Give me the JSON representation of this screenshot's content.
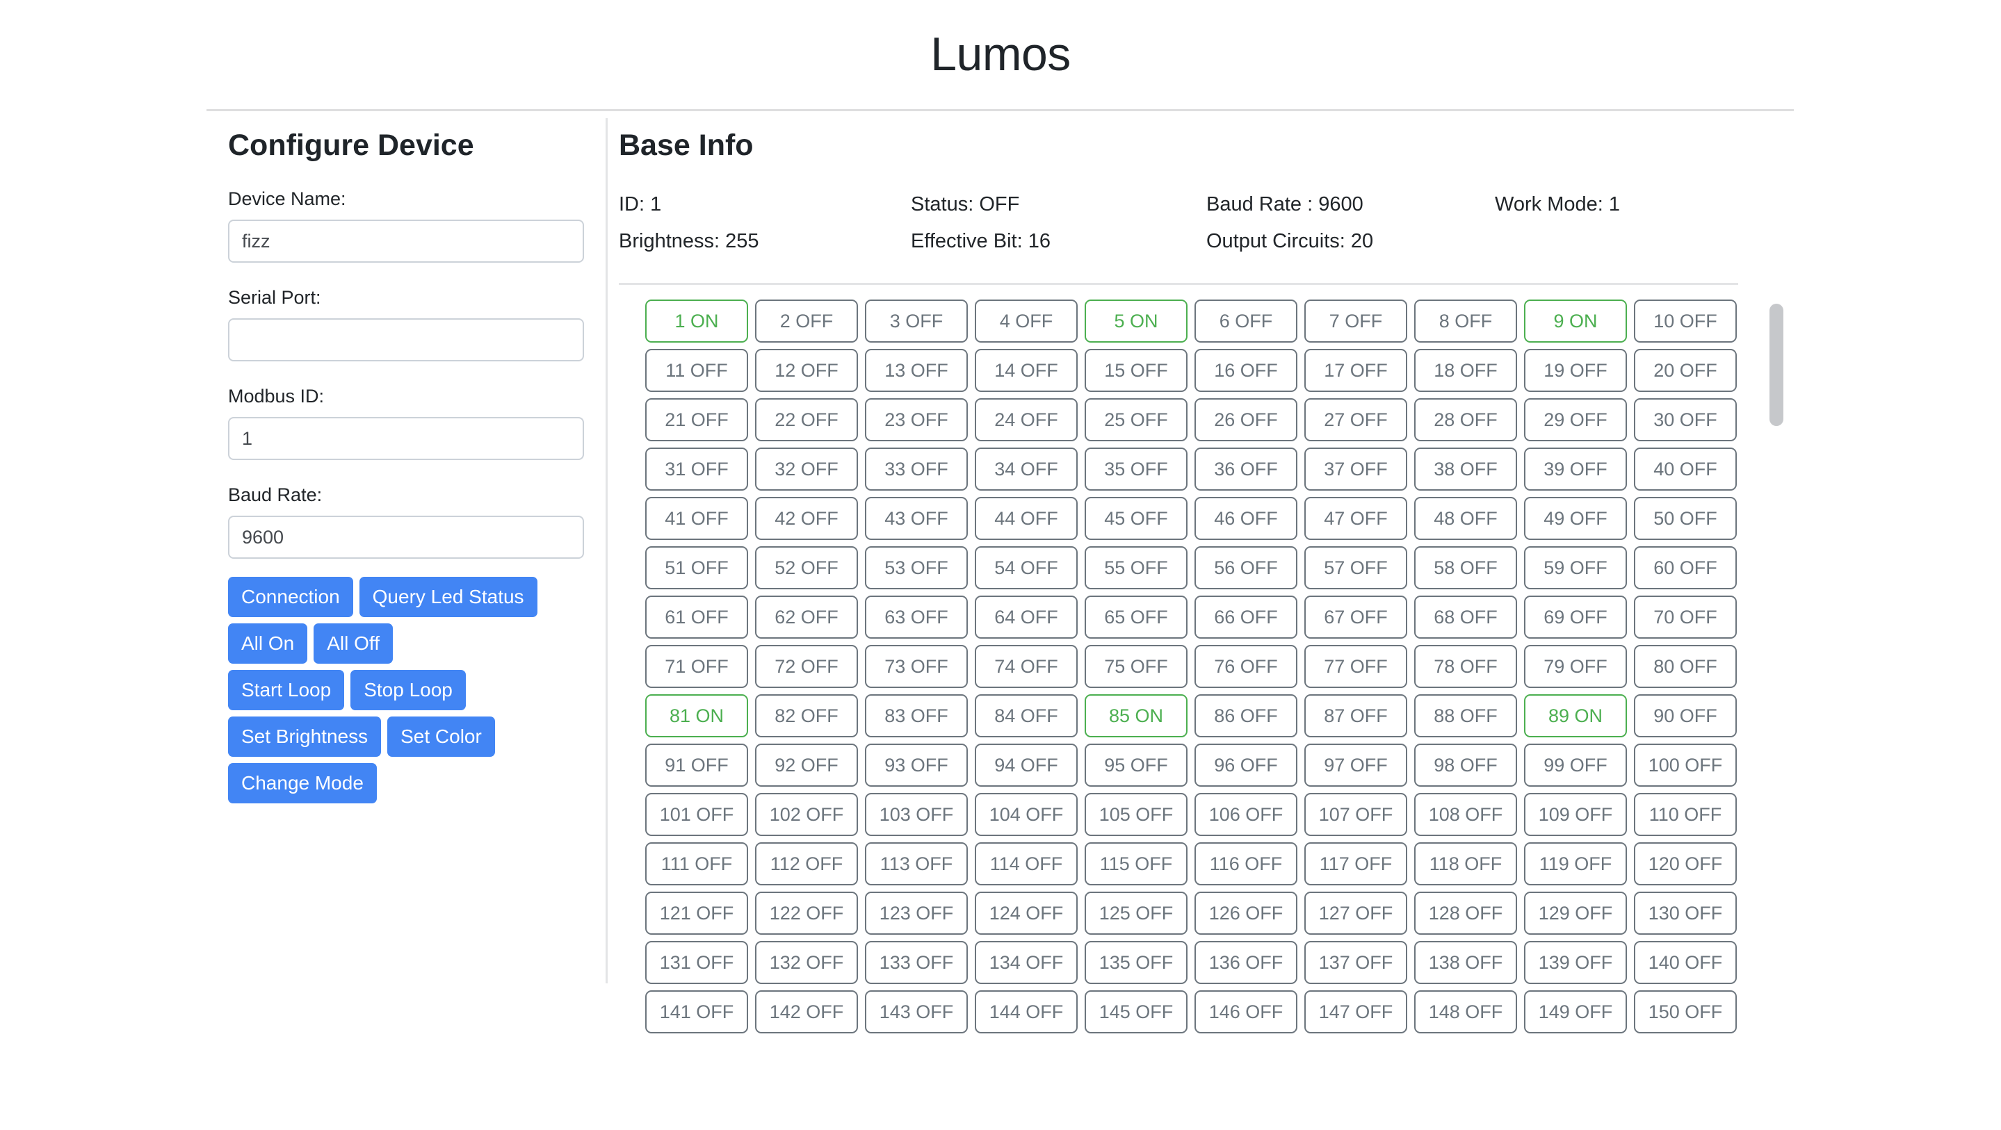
{
  "app": {
    "title": "Lumos"
  },
  "sidebar": {
    "heading": "Configure Device",
    "fields": [
      {
        "label": "Device Name:",
        "value": "fizz",
        "placeholder": ""
      },
      {
        "label": "Serial Port:",
        "value": "",
        "placeholder": ""
      },
      {
        "label": "Modbus ID:",
        "value": "1",
        "placeholder": ""
      },
      {
        "label": "Baud Rate:",
        "value": "9600",
        "placeholder": ""
      }
    ],
    "button_rows": [
      [
        "Connection",
        "Query Led Status"
      ],
      [
        "All On",
        "All Off"
      ],
      [
        "Start Loop",
        "Stop Loop"
      ],
      [
        "Set Brightness",
        "Set Color"
      ],
      [
        "Change Mode"
      ]
    ]
  },
  "main": {
    "heading": "Base Info",
    "info": [
      "ID: 1",
      "Status: OFF",
      "Baud Rate : 9600",
      "Work Mode: 1",
      "Brightness: 255",
      "Effective Bit: 16",
      "Output Circuits: 20",
      ""
    ],
    "led": {
      "count": 150,
      "on_indices": [
        1,
        5,
        9,
        81,
        85,
        89
      ],
      "on_suffix": "ON",
      "off_suffix": "OFF"
    }
  },
  "colors": {
    "accent_blue": "#4285f4",
    "on_green": "#4caf50",
    "off_gray": "#6c757d",
    "scrollbar": "#c6c8cb"
  }
}
